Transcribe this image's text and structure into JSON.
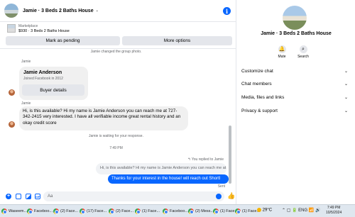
{
  "header": {
    "title": "Jamie · 3 Beds 2 Baths House",
    "caret": "⌄"
  },
  "listing": {
    "category": "Marketplace",
    "title": "$930 · 3 Beds 2 Baths House",
    "pending_label": "Mark as pending",
    "more_label": "More options"
  },
  "messages": {
    "photo_changed": "Jamie changed the group photo.",
    "sender_top": "Jamie",
    "profile_name": "Jamie Anderson",
    "profile_joined": "Joined Facebook in 2012",
    "buyer_details_label": "Buyer details",
    "sender_mid": "Jamie",
    "incoming_text": "Hi, is this available? Hi my name is Jamie Anderson you can reach me at 727-342-2415 very interested. I have all verifiable income great rental history and an okay credit score",
    "waiting": "Jamie is waiting for your response.",
    "time": "7:49 PM",
    "replied_to": "↰ You replied to Jamie",
    "quote_text": "Hi, is this available? Hi my name is Jamie Anderson you can reach me at ...",
    "outgoing_text": "Thanks for your interest in the house! will reach out Shortl",
    "sent_label": "Sent"
  },
  "composer": {
    "placeholder": "Aa",
    "gif_label": "GIF"
  },
  "side": {
    "title": "Jamie · 3 Beds 2 Baths House",
    "mute_label": "Mute",
    "search_label": "Search",
    "sections": [
      "Customize chat",
      "Chat members",
      "Media, files and links",
      "Privacy & support"
    ],
    "chevron": "⌄"
  },
  "taskbar": {
    "items": [
      "Waseem...",
      "Faceboo...",
      "(2) Face...",
      "(17) Face...",
      "(2) Face...",
      "(1) Face...",
      "Faceboo...",
      "(2) Mess...",
      "(1) Face...",
      "(1) Face..."
    ],
    "temperature": "29°C",
    "lang": "ENG",
    "time": "7:49 PM",
    "date": "10/5/2024"
  },
  "colors": {
    "accent": "#0866ff",
    "bubble_in": "#f0f0f0",
    "button_gray": "#e4e6eb"
  }
}
